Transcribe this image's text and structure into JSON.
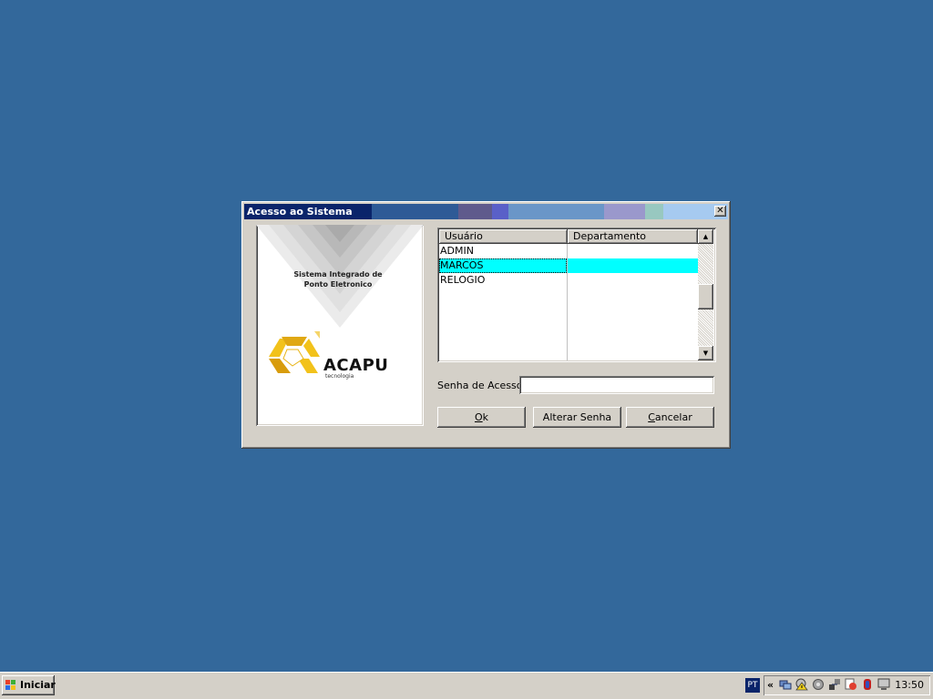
{
  "dialog": {
    "title": "Acesso ao Sistema",
    "close_label": "✕",
    "logo": {
      "subtitle": "Sistema Integrado de\nPonto Eletronico",
      "brand": "ACAPU",
      "tagline": "tecnologia"
    },
    "list": {
      "columns": [
        "Usuário",
        "Departamento"
      ],
      "rows": [
        {
          "user": "ADMIN",
          "dept": ""
        },
        {
          "user": "MARCOS",
          "dept": ""
        },
        {
          "user": "RELOGIO",
          "dept": ""
        }
      ],
      "selected_row_color": "#00ffff"
    },
    "password": {
      "label": "Senha de Acesso:",
      "value": ""
    },
    "buttons": {
      "ok_mnemonic": "O",
      "ok_rest": "k",
      "alterar_label": "Alterar Senha",
      "cancelar_mnemonic": "C",
      "cancelar_rest": "ancelar"
    }
  },
  "taskbar": {
    "start_label": "Iniciar",
    "language": "PT",
    "tray_expand": "«",
    "tray_icons": [
      "network-icon",
      "security-warning-icon",
      "sound-icon",
      "network-connection-icon",
      "update-icon",
      "antivirus-icon",
      "display-icon"
    ],
    "clock": "13:50"
  },
  "colors": {
    "desktop": "#33689b",
    "titlebar_active": "#0a246a",
    "window_face": "#d4d0c8",
    "logo_yellow": "#f2c21b"
  }
}
